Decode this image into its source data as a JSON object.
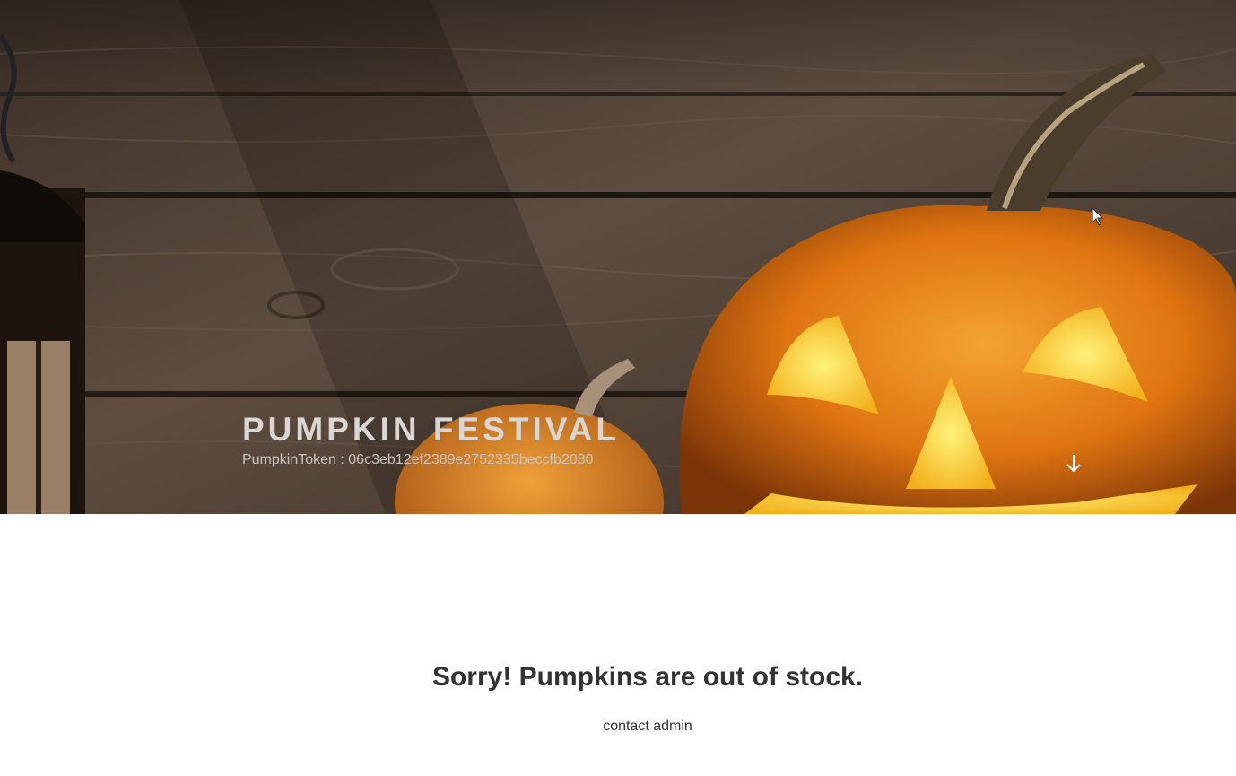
{
  "header": {
    "site_title": "PUMPKIN FESTIVAL",
    "site_description": "PumpkinToken : 06c3eb12ef2389e2752335beccfb2080",
    "scroll_icon": "arrow-down-icon"
  },
  "main": {
    "heading": "Sorry! Pumpkins are out of stock.",
    "contact_link": "contact admin"
  },
  "colors": {
    "title_text": "#d9d6d3",
    "body_text": "#333333",
    "pumpkin": "#e07a10",
    "wood": "#4a3a2e"
  }
}
